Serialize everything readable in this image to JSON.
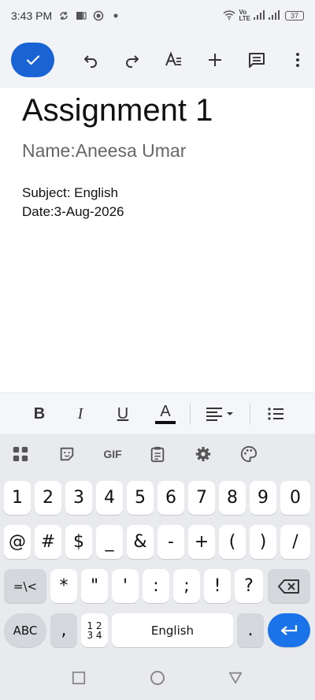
{
  "status_bar": {
    "time": "3:43 PM",
    "network_label": "Vo\nLTE",
    "battery": "37"
  },
  "toolbar": {
    "icons": [
      "check-icon",
      "undo-icon",
      "redo-icon",
      "text-format-icon",
      "add-icon",
      "comment-icon",
      "more-icon"
    ]
  },
  "document": {
    "title": "Assignment 1",
    "subtitle": "Name:Aneesa Umar",
    "lines": [
      "Subject: English",
      "Date:3-Aug-2026"
    ]
  },
  "format_bar": {
    "bold": "B",
    "italic": "I",
    "underline": "U",
    "text_color": "A",
    "underline_color": "#111111"
  },
  "keyboard": {
    "tools": [
      "apps-icon",
      "sticker-icon",
      "GIF",
      "clipboard-icon",
      "settings-icon",
      "palette-icon"
    ],
    "row1": [
      "1",
      "2",
      "3",
      "4",
      "5",
      "6",
      "7",
      "8",
      "9",
      "0"
    ],
    "row2": [
      "@",
      "#",
      "$",
      "_",
      "&",
      "-",
      "+",
      "(",
      ")",
      "/"
    ],
    "row3_left": "=\\<",
    "row3": [
      "*",
      "\"",
      "'",
      ":",
      ";",
      "!",
      "?"
    ],
    "row4": {
      "abc": "ABC",
      "comma": ",",
      "numpad": "1 2\n3 4",
      "space": "English",
      "period": "."
    }
  },
  "colors": {
    "accent": "#1a73e8",
    "check_button": "#1a63d4"
  }
}
